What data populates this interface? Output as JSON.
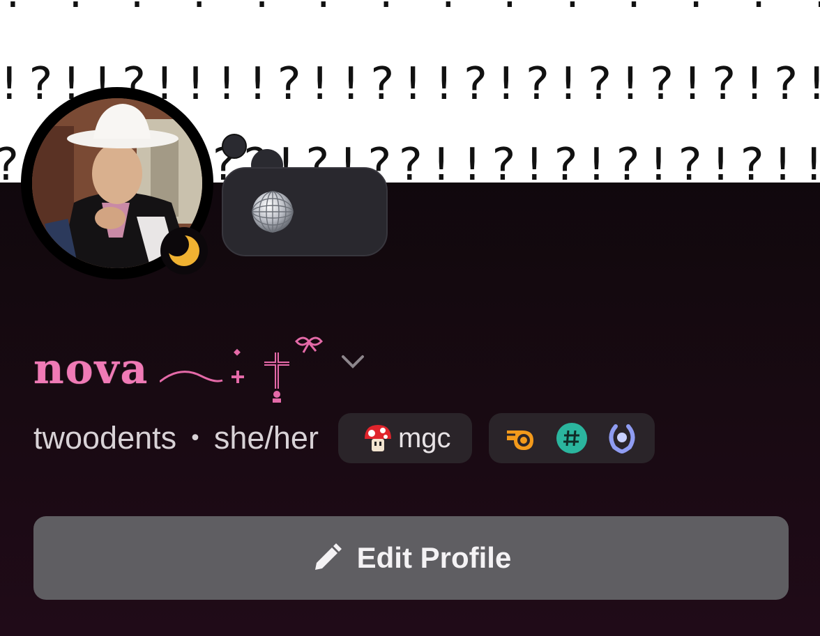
{
  "banner": {
    "row1": "? ! ? ? ! ? ! ! ? ! ? ? ! ! ? ! ! ? ! ? ? ! ? ? ! ? !",
    "row2": "!?!!?!!!!?!!?!!?!?!?!?!?!?!!?!?!!!?!!",
    "row3": "?!?!!?!??!?!??!!?!?!?!?!?!!?!?!?!"
  },
  "profile": {
    "display_name": "nova",
    "username": "twoodents",
    "separator": "•",
    "pronouns": "she/her",
    "tag": "mgc",
    "status_icon": "moon-icon",
    "custom_status_icon": "disco-ball-icon"
  },
  "badges": [
    "hypesquad-icon",
    "hashtag-icon",
    "laurel-icon"
  ],
  "actions": {
    "edit_label": "Edit Profile"
  },
  "colors": {
    "name_pink": "#f07ab6",
    "button_bg": "#5f5e62",
    "pill_bg": "#2a2429",
    "idle_yellow": "#f0b232"
  }
}
